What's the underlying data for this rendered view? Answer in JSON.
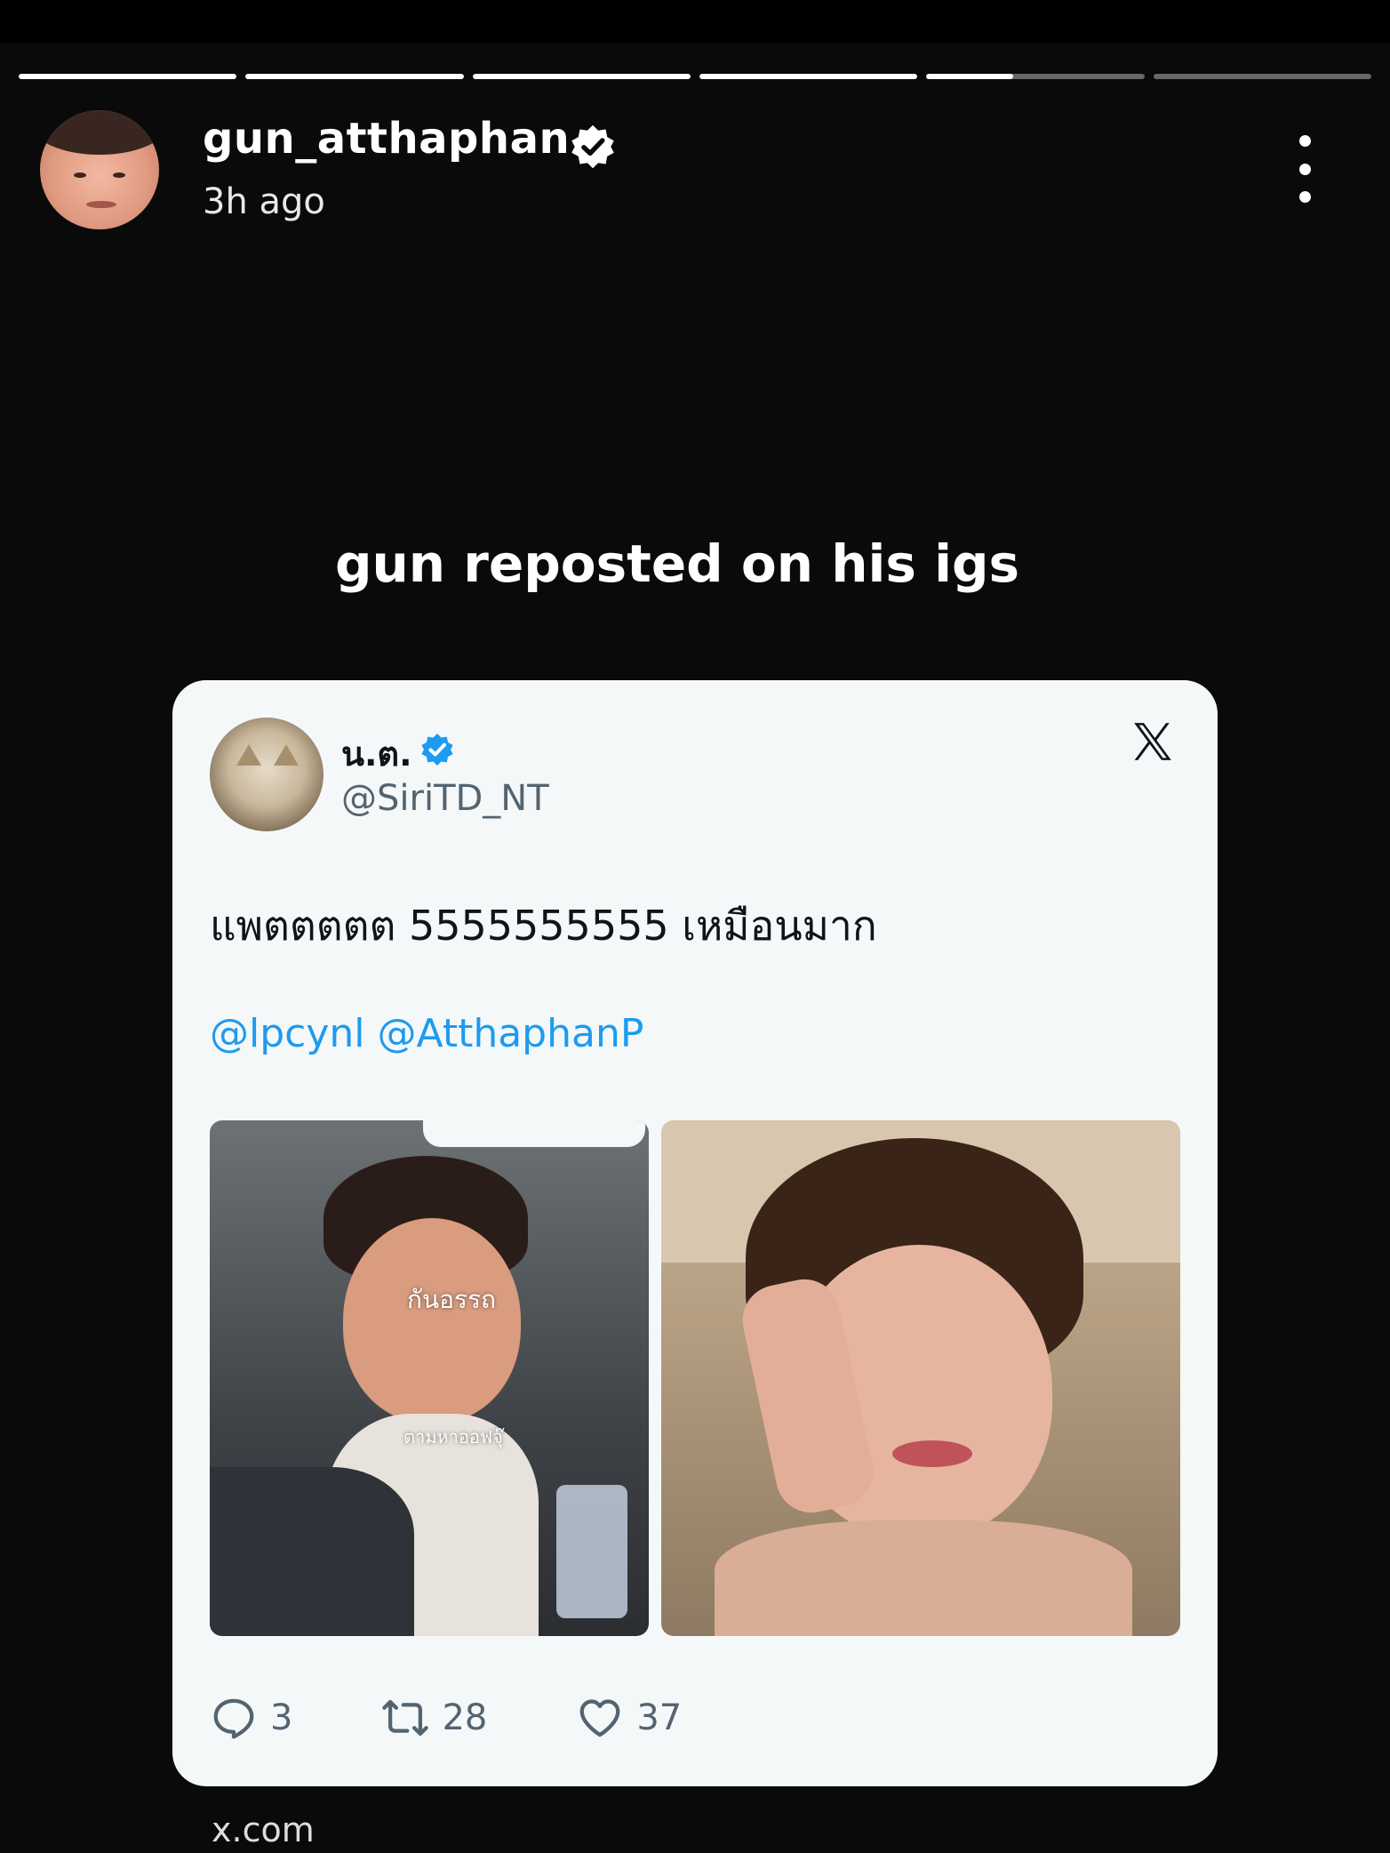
{
  "story": {
    "segments": 6,
    "completed": 4,
    "current_progress": 0.4
  },
  "header": {
    "username": "gun_atthaphan",
    "time": "3h ago"
  },
  "caption": "gun reposted on his igs",
  "tweet": {
    "display_name": "น.ต.",
    "handle": "@SiriTD_NT",
    "text": "แพตตตตต 5555555555 เหมือนมาก",
    "mentions": [
      "@lpcynl",
      "@AtthaphanP"
    ],
    "photo_left_labels": [
      "กันอรรถ",
      "ตามหาออฟจุ๊"
    ],
    "replies": "3",
    "reposts": "28",
    "likes": "37"
  },
  "source": "x.com",
  "colors": {
    "background": "#0a0a0a",
    "card": "#f5f8f8",
    "link": "#1d9bf0",
    "verified_blue": "#1d9bf0",
    "muted_text": "#536471"
  },
  "icons": [
    "verified-badge-icon",
    "more-vertical-icon",
    "verified-check-icon",
    "x-logo-icon",
    "reply-icon",
    "repost-icon",
    "like-icon"
  ]
}
